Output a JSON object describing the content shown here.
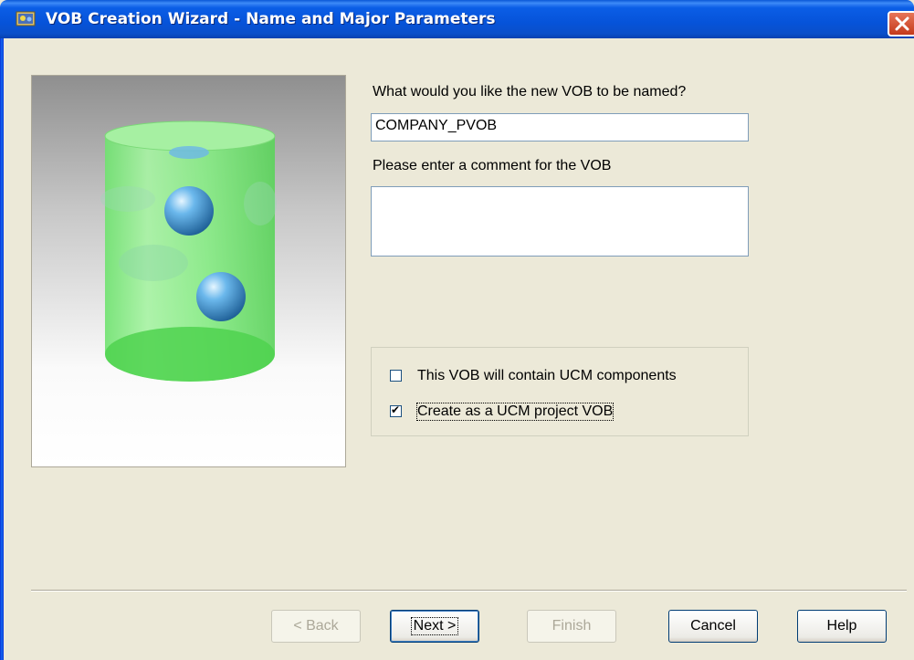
{
  "window": {
    "title": "VOB Creation Wizard - Name and Major Parameters",
    "icon": "vob-wizard-icon",
    "close_icon": "close-icon"
  },
  "form": {
    "name_label": "What would you like the new VOB to be named?",
    "name_value": "COMPANY_PVOB",
    "comment_label": "Please enter a comment for the VOB",
    "comment_value": ""
  },
  "options": [
    {
      "label": "This VOB will contain UCM components",
      "checked": false
    },
    {
      "label": "Create as a UCM project VOB",
      "checked": true
    }
  ],
  "buttons": {
    "back": "< Back",
    "next": "Next >",
    "finish": "Finish",
    "cancel": "Cancel",
    "help": "Help"
  },
  "colors": {
    "titlebar": "#0653d9",
    "close": "#c4391b",
    "dialog_bg": "#ece9d8"
  }
}
